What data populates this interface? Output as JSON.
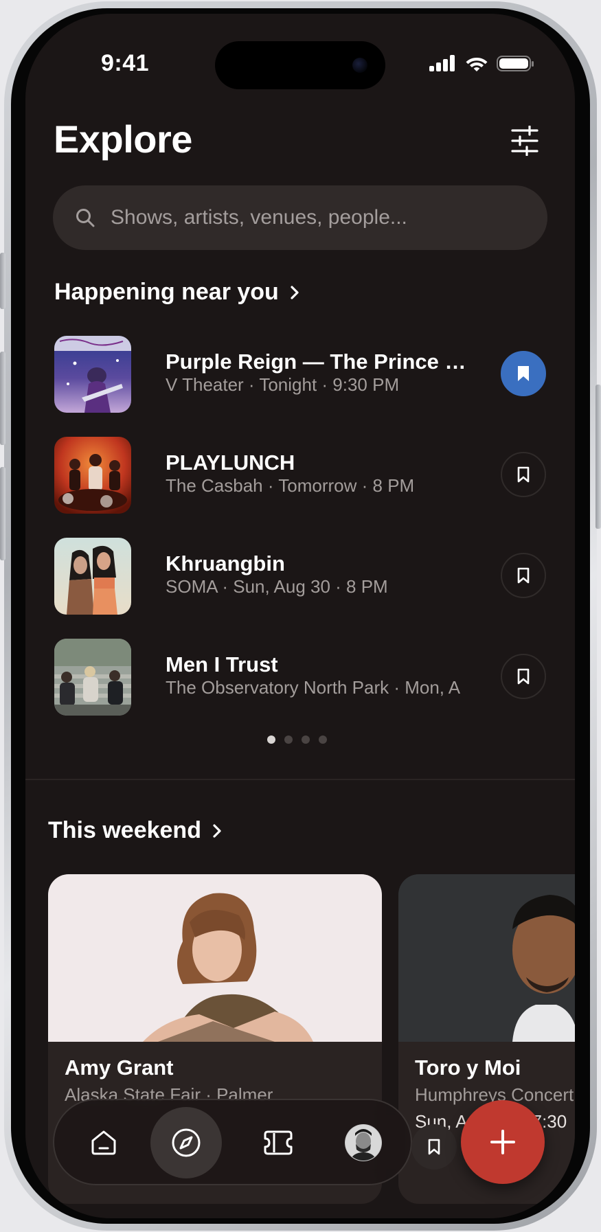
{
  "status_bar": {
    "time": "9:41"
  },
  "header": {
    "title": "Explore"
  },
  "search": {
    "placeholder": "Shows, artists, venues, people..."
  },
  "nearby": {
    "heading": "Happening near you",
    "events": [
      {
        "title": "Purple Reign — The Prince T...",
        "meta": "V Theater · Tonight · 9:30 PM",
        "saved": true
      },
      {
        "title": "PLAYLUNCH",
        "meta": "The Casbah · Tomorrow · 8 PM",
        "saved": false
      },
      {
        "title": "Khruangbin",
        "meta": "SOMA · Sun, Aug 30 · 8 PM",
        "saved": false
      },
      {
        "title": "Men I Trust",
        "meta": "The Observatory North Park  ·  Mon, A",
        "saved": false
      }
    ],
    "pager": {
      "pages": 4,
      "current": 1
    }
  },
  "weekend": {
    "heading": "This weekend",
    "cards": [
      {
        "name": "Amy Grant",
        "venue": "Alaska State Fair · Palmer",
        "when": ""
      },
      {
        "name": "Toro y Moi",
        "venue": "Humphreys Concert",
        "when": "Sun, A",
        "time": "7:30"
      }
    ]
  },
  "tab_bar": {
    "active": "explore",
    "tabs": [
      "home",
      "explore",
      "tickets",
      "profile"
    ]
  },
  "colors": {
    "background": "#1b1616",
    "accent_saved": "#3a6fc0",
    "fab": "#c0392f"
  }
}
